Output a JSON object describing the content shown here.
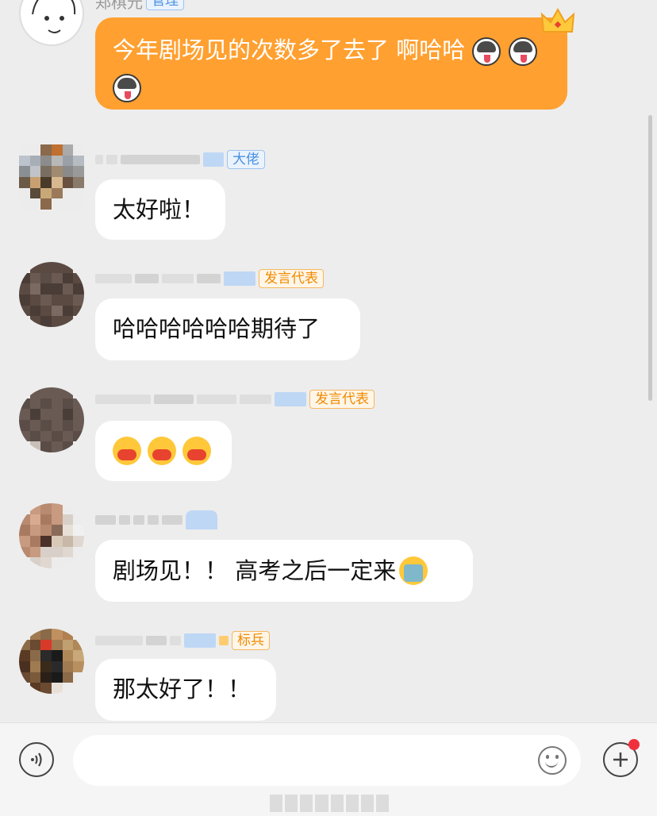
{
  "top_message": {
    "sender": "郑棋元",
    "tag": "管理",
    "text": "今年剧场见的次数多了去了 啊哈哈",
    "emoji_names": [
      "husky-tongue-emoji",
      "husky-tongue-emoji",
      "husky-tongue-emoji"
    ]
  },
  "messages": [
    {
      "tag": "大佬",
      "tag_color": "blue",
      "text": "太好啦！"
    },
    {
      "tag": "发言代表",
      "tag_color": "orange",
      "text": "哈哈哈哈哈哈期待了"
    },
    {
      "tag": "发言代表",
      "tag_color": "orange",
      "text": "",
      "emoji_names": [
        "hug-face-emoji",
        "hug-face-emoji",
        "hug-face-emoji"
      ]
    },
    {
      "text": "剧场见！！ 高考之后一定来",
      "emoji_names": [
        "loudly-crying-emoji"
      ]
    },
    {
      "tag": "标兵",
      "tag_color": "orange",
      "text": "那太好了！！"
    }
  ],
  "colors": {
    "accent_bubble": "#ffa030",
    "background": "#ededed",
    "tag_blue": "#4a90e2",
    "tag_orange": "#f08a00"
  },
  "toolbar": {
    "voice_icon": "voice-icon",
    "emoji_icon": "smile-icon",
    "plus_icon": "plus-icon",
    "input_placeholder": ""
  }
}
